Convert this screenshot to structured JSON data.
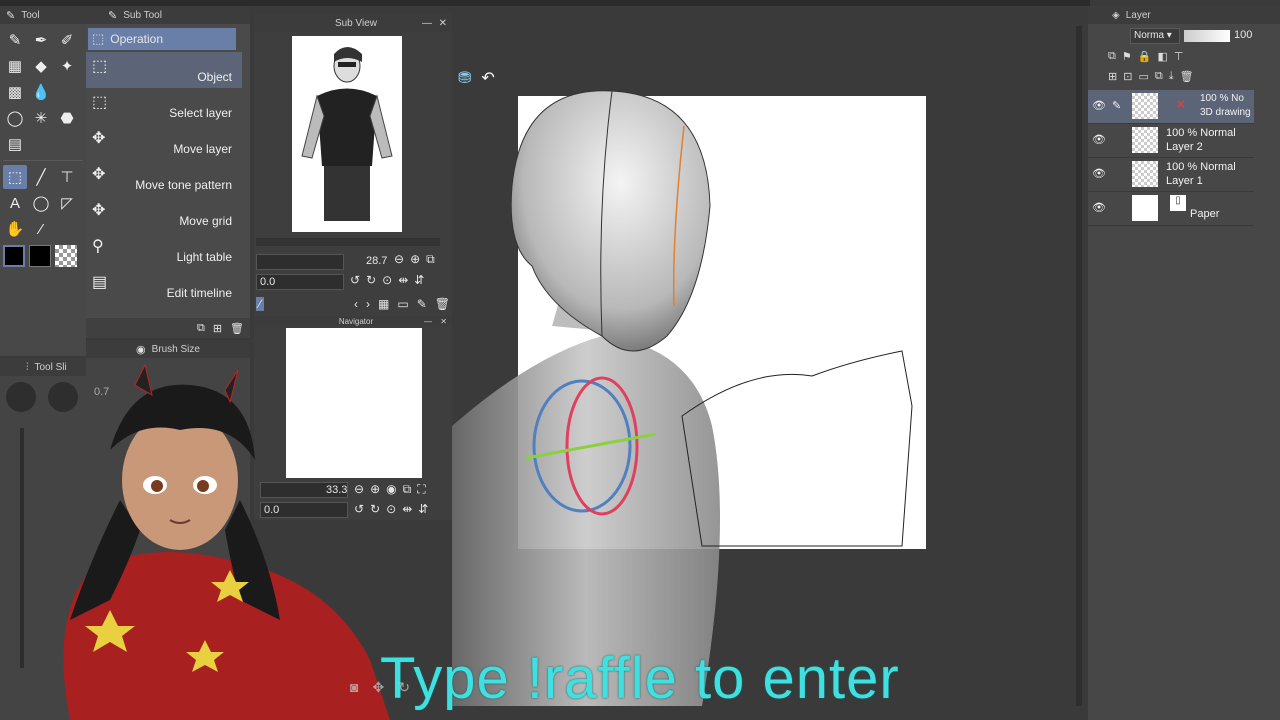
{
  "tool_panel": {
    "title": "Tool"
  },
  "subtool_panel": {
    "title": "Sub Tool",
    "group": "Operation",
    "items": [
      "Object",
      "Select layer",
      "Move layer",
      "Move tone pattern",
      "Move grid",
      "Light table",
      "Edit timeline"
    ]
  },
  "subview": {
    "title": "Sub View",
    "zoom": "28.7",
    "rotation": "0.0"
  },
  "navigator": {
    "title": "Navigator",
    "zoom": "33.3",
    "rotation": "0.0"
  },
  "brush_size": {
    "title": "Brush Size"
  },
  "tool_slider": {
    "title": "Tool Sli",
    "value": "0.7"
  },
  "layer_panel": {
    "title": "Layer",
    "blend_mode": "Norma",
    "opacity": "100",
    "layers": [
      {
        "line1": "100 % No",
        "line2": "3D drawing",
        "selected": true
      },
      {
        "line1": "100 % Normal",
        "line2": "Layer 2",
        "selected": false
      },
      {
        "line1": "100 % Normal",
        "line2": "Layer 1",
        "selected": false
      },
      {
        "line1": "",
        "line2": "Paper",
        "selected": false
      }
    ]
  },
  "overlay": {
    "caption": "Type !raffle to enter"
  },
  "colors": {
    "accent_select": "#6a7fa8",
    "caption": "#3ee0e0",
    "canvas": "#ffffff"
  }
}
